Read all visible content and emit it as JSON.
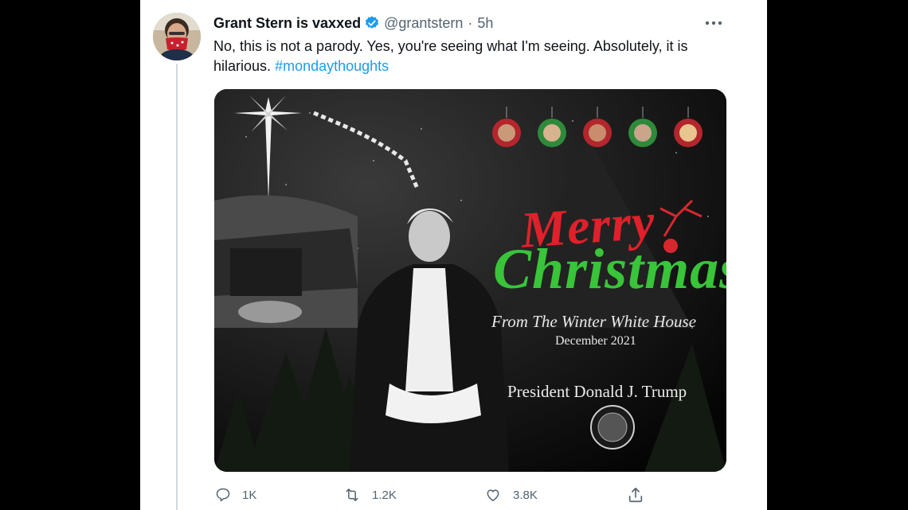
{
  "tweet": {
    "display_name": "Grant Stern is vaxxed",
    "handle": "@grantstern",
    "separator": "·",
    "time": "5h",
    "text_main": "No, this is not a parody. Yes, you're seeing what I'm seeing. Absolutely, it is hilarious.",
    "hashtag": "#mondaythoughts"
  },
  "card": {
    "merry": "Merry",
    "christmas": "Christmas",
    "from": "From The Winter White House",
    "date": "December 2021",
    "signature": "President Donald J. Trump"
  },
  "actions": {
    "reply_count": "1K",
    "retweet_count": "1.2K",
    "like_count": "3.8K"
  },
  "colors": {
    "accent": "#1d9bf0",
    "secondary_text": "#536471",
    "merry_red": "#e0202a",
    "christmas_green": "#39c43a"
  },
  "icons": [
    "verified-badge-icon",
    "more-options-icon",
    "reply-icon",
    "retweet-icon",
    "like-icon",
    "share-icon"
  ]
}
